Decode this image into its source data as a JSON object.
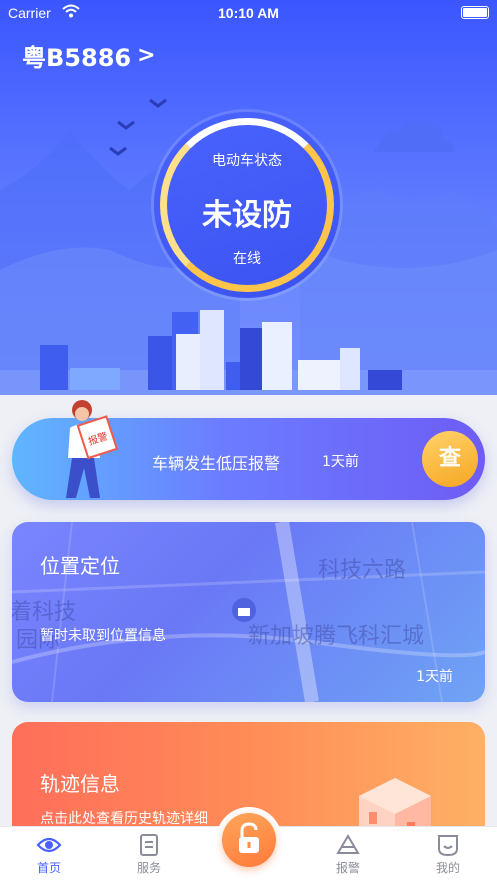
{
  "status_bar": {
    "carrier": "Carrier",
    "time": "10:10 AM"
  },
  "vehicle": {
    "plate": "粤B5886",
    "chevron": ">"
  },
  "gauge": {
    "label": "电动车状态",
    "status": "未设防",
    "connection": "在线"
  },
  "alarm": {
    "stamp": "报警",
    "message": "车辆发生低压报警",
    "time_ago": "1天前",
    "check_label": "查"
  },
  "location": {
    "title": "位置定位",
    "message": "暂时未取到位置信息",
    "time_ago": "1天前",
    "map_labels": [
      "科技六路",
      "新加坡腾飞科汇城",
      "着科技",
      "园际"
    ]
  },
  "track": {
    "title": "轨迹信息",
    "description": "点击此处查看历史轨迹详细"
  },
  "tabs": [
    {
      "label": "首页",
      "icon": "eye-icon",
      "active": true
    },
    {
      "label": "服务",
      "icon": "document-icon",
      "active": false
    },
    {
      "label": "",
      "icon": "unlock-icon",
      "active": false
    },
    {
      "label": "报警",
      "icon": "warning-icon",
      "active": false
    },
    {
      "label": "我的",
      "icon": "profile-icon",
      "active": false
    }
  ],
  "colors": {
    "primary": "#3b56ff",
    "accent_orange": "#ff8c57",
    "ring_yellow": "#ffc54a",
    "tab_active": "#4a60ff"
  }
}
